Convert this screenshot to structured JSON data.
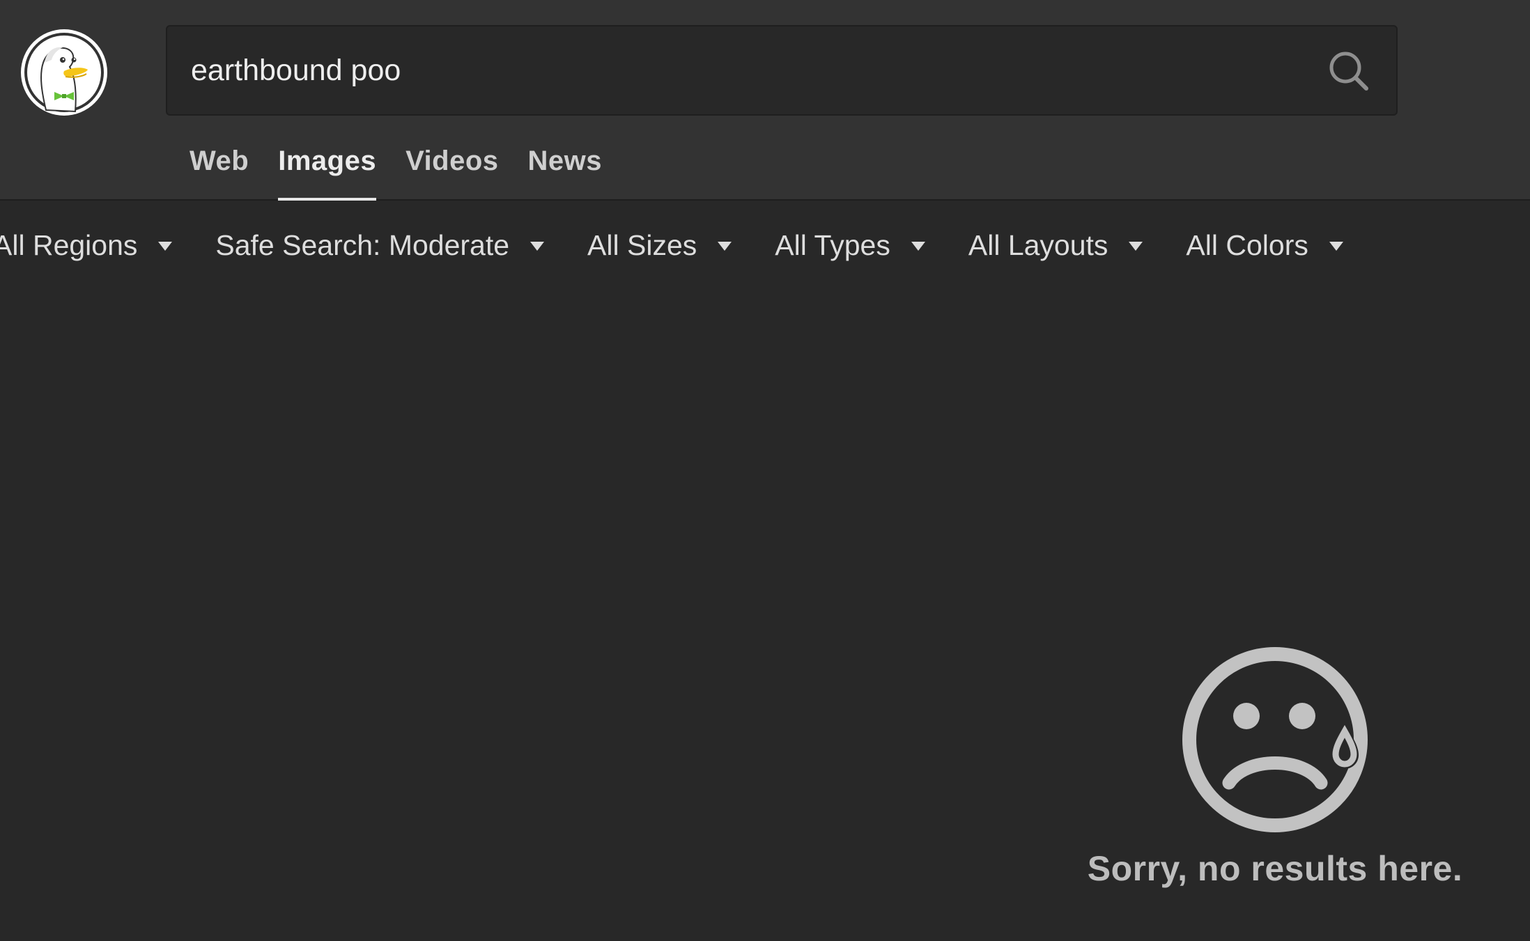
{
  "search": {
    "query": "earthbound poo"
  },
  "tabs": [
    {
      "label": "Web",
      "active": false
    },
    {
      "label": "Images",
      "active": true
    },
    {
      "label": "Videos",
      "active": false
    },
    {
      "label": "News",
      "active": false
    }
  ],
  "filters": [
    {
      "label": "All Regions"
    },
    {
      "label": "Safe Search: Moderate"
    },
    {
      "label": "All Sizes"
    },
    {
      "label": "All Types"
    },
    {
      "label": "All Layouts"
    },
    {
      "label": "All Colors"
    }
  ],
  "results": {
    "empty_message": "Sorry, no results here.",
    "empty_icon": "sad-face-tear-icon"
  },
  "colors": {
    "header_bg": "#333333",
    "page_bg": "#282828",
    "logo_beak": "#f5c518",
    "logo_bowtie": "#67c23a"
  },
  "icons": {
    "logo": "duckduckgo-logo-icon",
    "search": "search-icon",
    "filter_caret": "caret-down-icon"
  }
}
